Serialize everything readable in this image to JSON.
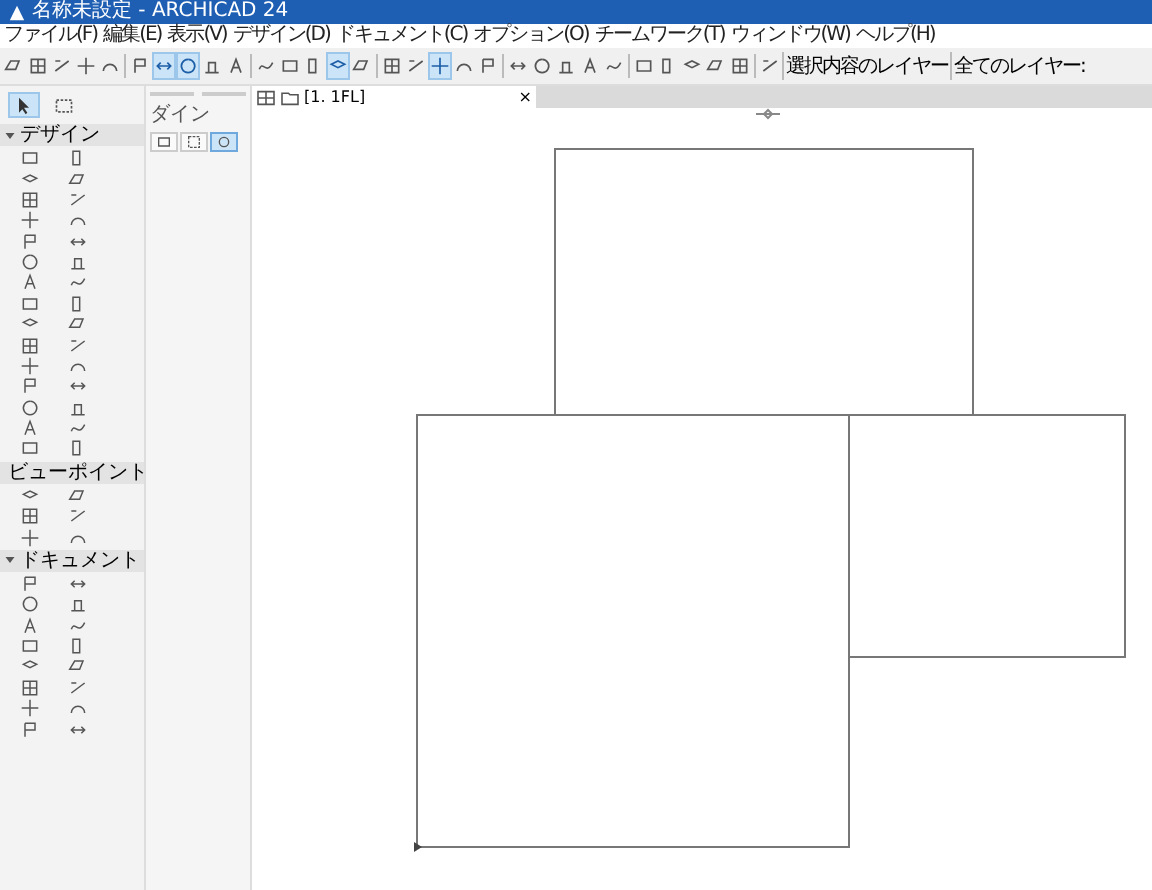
{
  "window": {
    "title": "名称未設定 - ARCHICAD 24"
  },
  "menu": [
    "ファイル(F)",
    "編集(E)",
    "表示(V)",
    "デザイン(D)",
    "ドキュメント(C)",
    "オプション(O)",
    "チームワーク(T)",
    "ウィンドウ(W)",
    "ヘルプ(H)"
  ],
  "toolbar": {
    "buttons": [
      {
        "selected": false
      },
      {
        "selected": false
      },
      {
        "selected": false
      },
      {
        "selected": false
      },
      {
        "selected": false
      },
      {
        "selected": false
      },
      {
        "selected": true
      },
      {
        "selected": true
      },
      {
        "selected": false
      },
      {
        "selected": false
      },
      {
        "selected": false
      },
      {
        "selected": false
      },
      {
        "selected": false
      },
      {
        "selected": true
      },
      {
        "selected": false
      },
      {
        "selected": false
      },
      {
        "selected": false
      },
      {
        "selected": true
      },
      {
        "selected": false
      },
      {
        "selected": false
      },
      {
        "selected": false
      },
      {
        "selected": false
      },
      {
        "selected": false
      },
      {
        "selected": false
      },
      {
        "selected": false
      },
      {
        "selected": false
      },
      {
        "selected": false
      },
      {
        "selected": false
      },
      {
        "selected": false
      },
      {
        "selected": false
      },
      {
        "selected": false
      }
    ],
    "layer_labels": [
      "選択内容のレイヤー",
      "全てのレイヤー:"
    ]
  },
  "toolbox": {
    "selection_tools": [
      {
        "selected": true
      },
      {
        "selected": false
      }
    ],
    "sections": [
      {
        "title": "デザイン",
        "expanded": true
      },
      {
        "title": "ビューポイント",
        "expanded": true
      },
      {
        "title": "ドキュメント",
        "expanded": true
      }
    ]
  },
  "info_box": {
    "label": "ダイン"
  },
  "tab": {
    "label": "[1. 1FL]",
    "close": "×"
  }
}
